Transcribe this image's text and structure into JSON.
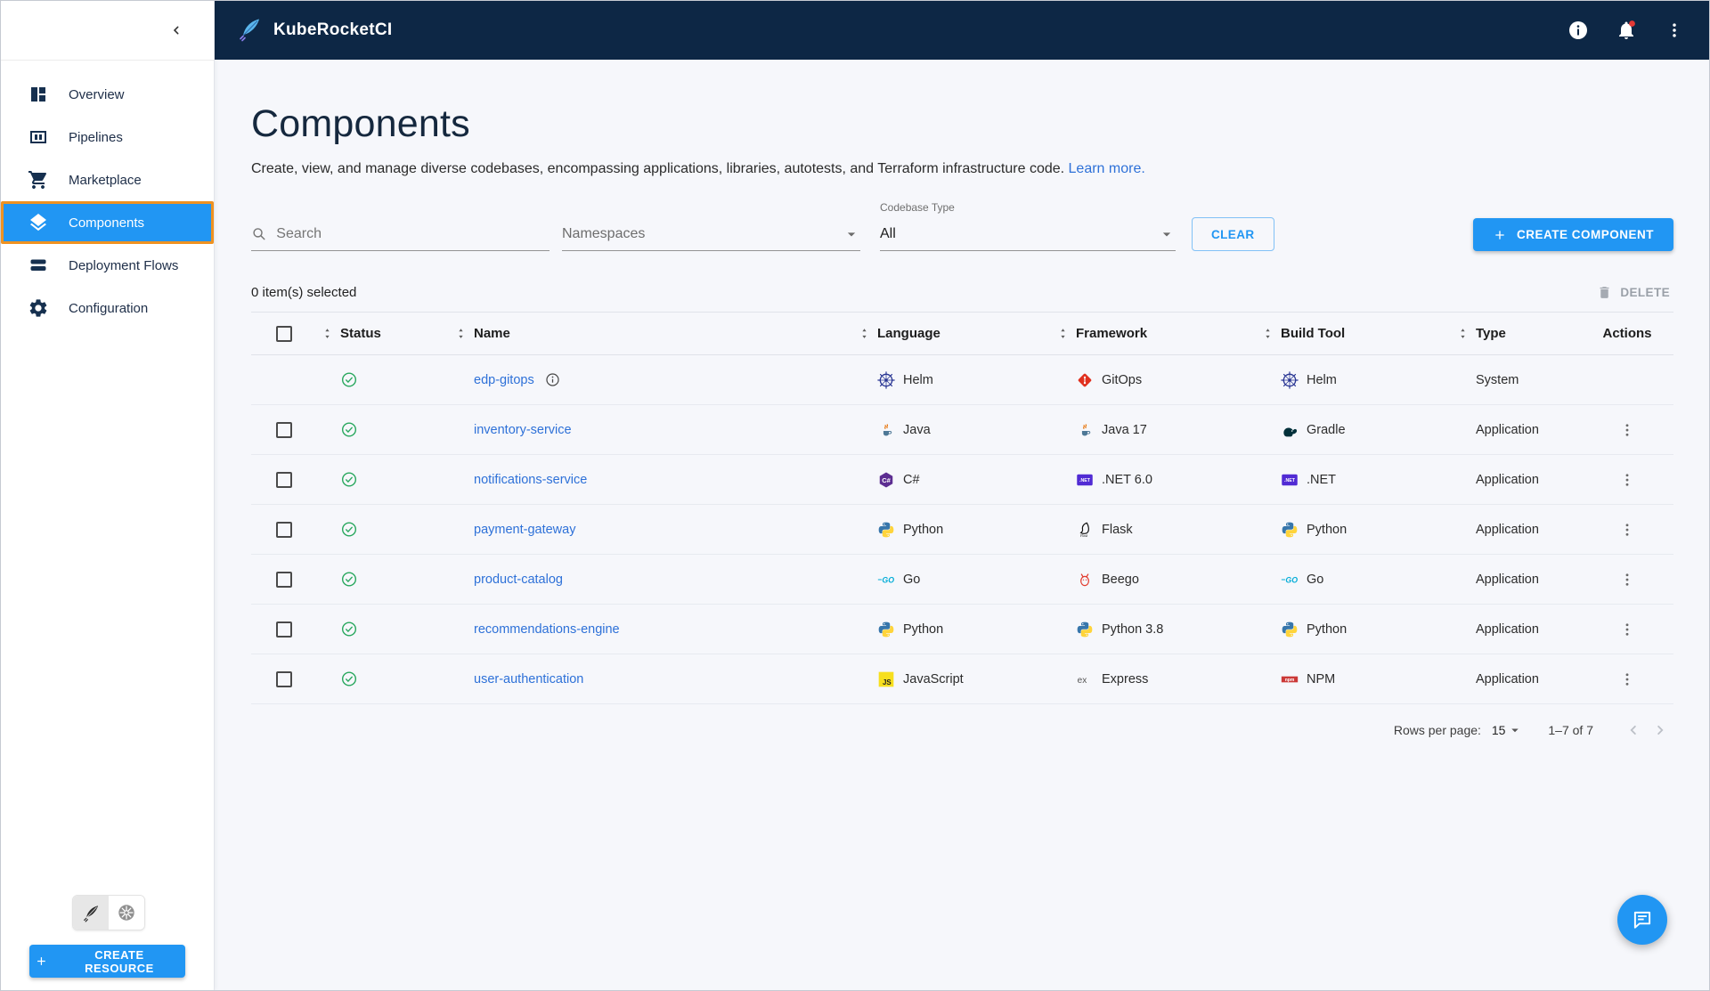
{
  "topbar": {
    "app_title": "KubeRocketCI"
  },
  "sidebar": {
    "items": [
      {
        "label": "Overview",
        "icon": "overview",
        "active": false
      },
      {
        "label": "Pipelines",
        "icon": "pipelines",
        "active": false
      },
      {
        "label": "Marketplace",
        "icon": "marketplace",
        "active": false
      },
      {
        "label": "Components",
        "icon": "components",
        "active": true
      },
      {
        "label": "Deployment Flows",
        "icon": "deployment-flows",
        "active": false
      },
      {
        "label": "Configuration",
        "icon": "configuration",
        "active": false
      }
    ],
    "create_resource_label": "CREATE RESOURCE"
  },
  "page": {
    "title": "Components",
    "description": "Create, view, and manage diverse codebases, encompassing applications, libraries, autotests, and Terraform infrastructure code.",
    "learn_more_label": "Learn more."
  },
  "filters": {
    "search_placeholder": "Search",
    "namespaces_placeholder": "Namespaces",
    "codebase_type_label": "Codebase Type",
    "codebase_type_value": "All",
    "clear_label": "CLEAR",
    "create_component_label": "CREATE COMPONENT"
  },
  "table": {
    "selected_text": "0 item(s) selected",
    "delete_label": "DELETE",
    "columns": [
      {
        "label": "Status",
        "sortable": true
      },
      {
        "label": "Name",
        "sortable": true
      },
      {
        "label": "Language",
        "sortable": true
      },
      {
        "label": "Framework",
        "sortable": true
      },
      {
        "label": "Build Tool",
        "sortable": true
      },
      {
        "label": "Type",
        "sortable": true
      },
      {
        "label": "Actions",
        "sortable": false
      }
    ],
    "rows": [
      {
        "name": "edp-gitops",
        "status": "success",
        "language": "Helm",
        "language_icon": "helm",
        "framework": "GitOps",
        "framework_icon": "gitops",
        "build_tool": "Helm",
        "build_tool_icon": "helm",
        "type": "System",
        "has_checkbox": false,
        "has_info": true,
        "has_actions": false
      },
      {
        "name": "inventory-service",
        "status": "success",
        "language": "Java",
        "language_icon": "java",
        "framework": "Java 17",
        "framework_icon": "java",
        "build_tool": "Gradle",
        "build_tool_icon": "gradle",
        "type": "Application",
        "has_checkbox": true,
        "has_info": false,
        "has_actions": true
      },
      {
        "name": "notifications-service",
        "status": "success",
        "language": "C#",
        "language_icon": "csharp",
        "framework": ".NET 6.0",
        "framework_icon": "dotnet",
        "build_tool": ".NET",
        "build_tool_icon": "dotnet",
        "type": "Application",
        "has_checkbox": true,
        "has_info": false,
        "has_actions": true
      },
      {
        "name": "payment-gateway",
        "status": "success",
        "language": "Python",
        "language_icon": "python",
        "framework": "Flask",
        "framework_icon": "flask",
        "build_tool": "Python",
        "build_tool_icon": "python",
        "type": "Application",
        "has_checkbox": true,
        "has_info": false,
        "has_actions": true
      },
      {
        "name": "product-catalog",
        "status": "success",
        "language": "Go",
        "language_icon": "go",
        "framework": "Beego",
        "framework_icon": "beego",
        "build_tool": "Go",
        "build_tool_icon": "go",
        "type": "Application",
        "has_checkbox": true,
        "has_info": false,
        "has_actions": true
      },
      {
        "name": "recommendations-engine",
        "status": "success",
        "language": "Python",
        "language_icon": "python",
        "framework": "Python 3.8",
        "framework_icon": "python",
        "build_tool": "Python",
        "build_tool_icon": "python",
        "type": "Application",
        "has_checkbox": true,
        "has_info": false,
        "has_actions": true
      },
      {
        "name": "user-authentication",
        "status": "success",
        "language": "JavaScript",
        "language_icon": "javascript",
        "framework": "Express",
        "framework_icon": "express",
        "build_tool": "NPM",
        "build_tool_icon": "npm",
        "type": "Application",
        "has_checkbox": true,
        "has_info": false,
        "has_actions": true
      }
    ],
    "pagination": {
      "rows_per_page_label": "Rows per page:",
      "rows_per_page_value": "15",
      "range_text": "1–7 of 7"
    }
  },
  "colors": {
    "topbar_bg": "#0d2745",
    "accent": "#2196f3",
    "active_outline": "#ef9221",
    "success": "#2aa85f",
    "link": "#2e71d8",
    "notification_badge": "#e53935"
  }
}
